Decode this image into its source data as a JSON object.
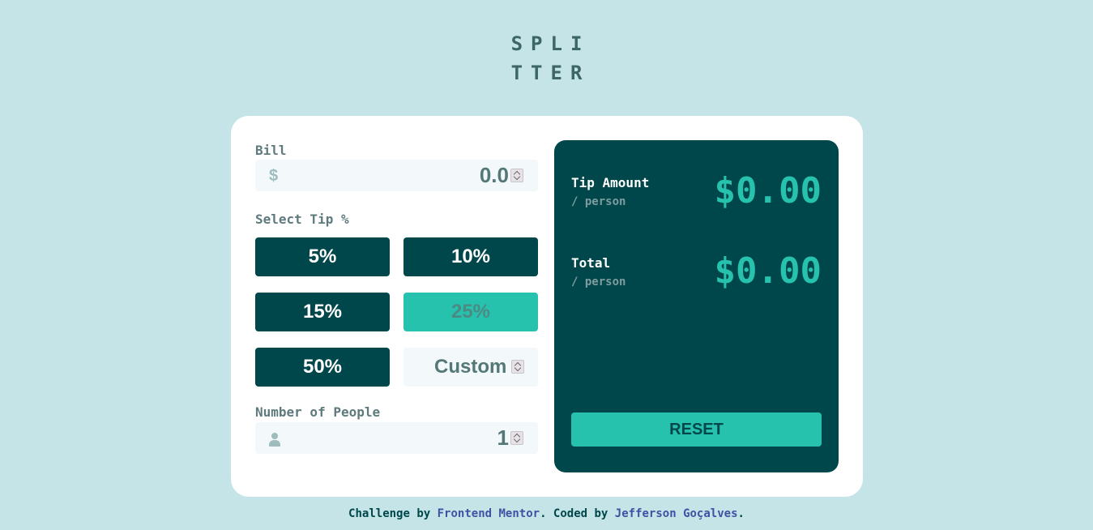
{
  "logo": {
    "line1": "SPLI",
    "line2": "TTER"
  },
  "bill": {
    "label": "Bill",
    "prefix": "$",
    "value": "0.0"
  },
  "tip": {
    "label": "Select Tip %",
    "options": [
      "5%",
      "10%",
      "15%",
      "25%",
      "50%"
    ],
    "selected": "25%",
    "custom_placeholder": "Custom"
  },
  "people": {
    "label": "Number of People",
    "value": "1"
  },
  "results": {
    "tip_amount_label": "Tip Amount",
    "per_person": "/ person",
    "tip_amount_value": "$0.00",
    "total_label": "Total",
    "total_value": "$0.00",
    "reset_label": "RESET"
  },
  "footer": {
    "prefix": "Challenge by ",
    "frontend_mentor": "Frontend Mentor",
    "middle": ". Coded by ",
    "author": "Jefferson Goçalves",
    "suffix": "."
  },
  "colors": {
    "background": "#c5e4e7",
    "dark_cyan": "#00474b",
    "strong_cyan": "#26c2ad",
    "link": "#3e52a3"
  }
}
